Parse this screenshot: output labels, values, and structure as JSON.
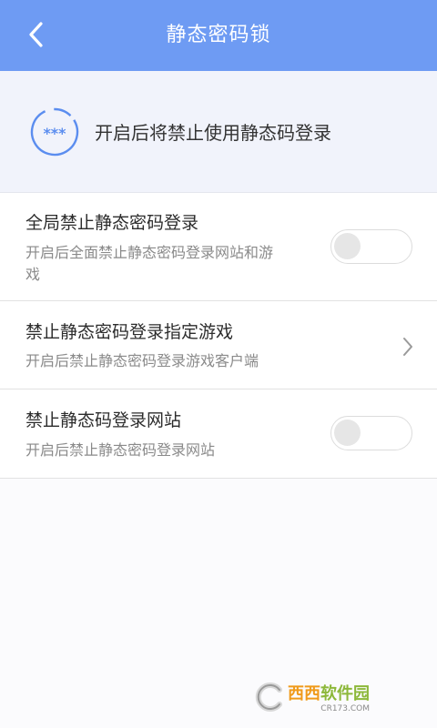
{
  "header": {
    "title": "静态密码锁",
    "back_icon": "chevron-left-icon"
  },
  "banner": {
    "text": "开启后将禁止使用静态码登录",
    "icon": "password-lock-icon",
    "icon_dots": "***"
  },
  "settings": [
    {
      "title": "全局禁止静态密码登录",
      "desc_line1": "开启后全面禁止静态密码登录网站和游",
      "desc_line2": "戏",
      "control": "toggle",
      "enabled": false
    },
    {
      "title": "禁止静态密码登录指定游戏",
      "desc_line1": "开启后禁止静态密码登录游戏客户端",
      "control": "chevron-right-icon"
    },
    {
      "title": "禁止静态码登录网站",
      "desc_line1": "开启后禁止静态密码登录网站",
      "control": "toggle",
      "enabled": false
    }
  ],
  "watermark": {
    "name_part1": "西西",
    "name_part2": "软件园",
    "domain": "CR173.COM"
  },
  "colors": {
    "header_bg": "#6e9bf3",
    "accent": "#5b8def",
    "banner_bg": "#f1f3fb"
  }
}
